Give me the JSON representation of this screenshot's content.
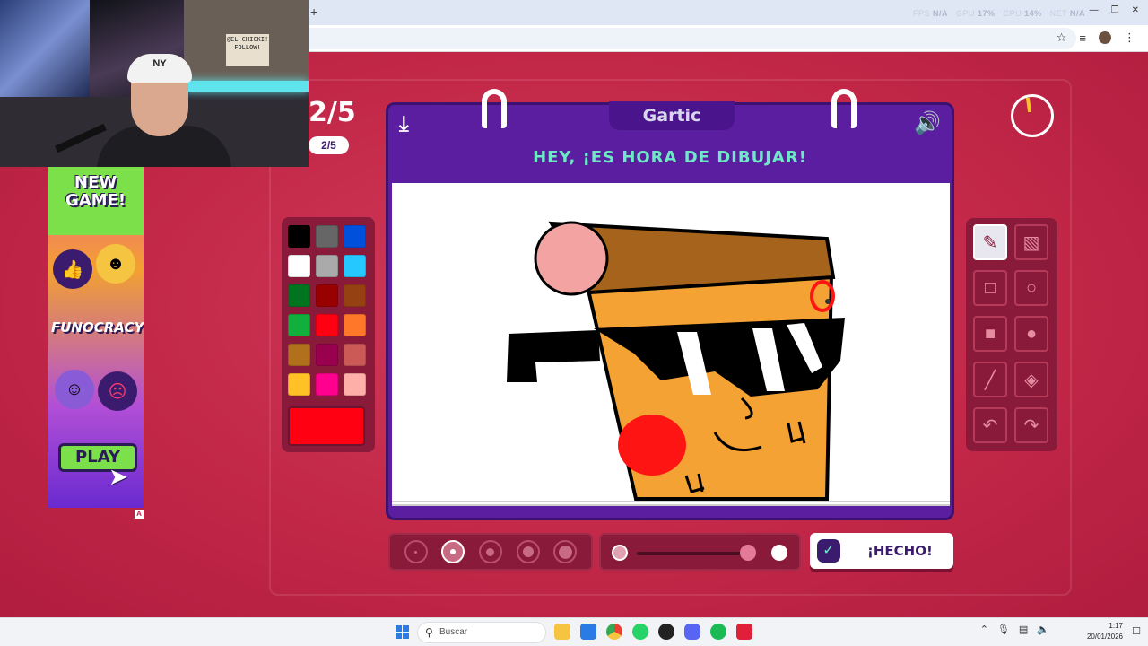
{
  "browser": {
    "newtab_glyph": "+",
    "metrics": [
      {
        "label": "FPS",
        "value": "N/A"
      },
      {
        "label": "GPU",
        "value": "17%"
      },
      {
        "label": "CPU",
        "value": "14%"
      },
      {
        "label": "NET",
        "value": "N/A"
      }
    ],
    "icons": [
      "star-icon",
      "reading-list-icon",
      "profile-avatar",
      "menu-icon"
    ]
  },
  "webcam": {
    "cap_text": "NY",
    "note_text": "@EL CHICKI! FOLLOW!"
  },
  "ad": {
    "headline": "NEW GAME!",
    "brand": "FUNOCRACY",
    "cta": "PLAY",
    "badge": "A"
  },
  "game": {
    "round_big": "2/5",
    "round_pill": "2/5",
    "logo": "Gartic",
    "prompt": "HEY, ¡ES HORA DE DIBUJAR!",
    "done_label": "¡HECHO!",
    "timer_icon": "timer-icon",
    "colors": {
      "palette": [
        "#000000",
        "#666666",
        "#0050dc",
        "#ffffff",
        "#aaaaaa",
        "#26c9ff",
        "#017420",
        "#990000",
        "#964112",
        "#11b03c",
        "#ff0013",
        "#ff7829",
        "#b0701c",
        "#99004e",
        "#cb5a57",
        "#ffc126",
        "#ff008f",
        "#feafa8"
      ],
      "current": "#ff0013",
      "accent": "#5b1ea0",
      "background": "#c9284a"
    },
    "tools": [
      {
        "name": "pencil",
        "icon": "pencil-icon",
        "active": true
      },
      {
        "name": "eraser",
        "icon": "eraser-icon",
        "active": false
      },
      {
        "name": "rectangle",
        "icon": "square-outline-icon",
        "active": false
      },
      {
        "name": "ellipse",
        "icon": "circle-outline-icon",
        "active": false
      },
      {
        "name": "filled-rectangle",
        "icon": "square-filled-icon",
        "active": false
      },
      {
        "name": "filled-ellipse",
        "icon": "circle-filled-icon",
        "active": false
      },
      {
        "name": "line",
        "icon": "line-icon",
        "active": false
      },
      {
        "name": "fill",
        "icon": "paint-bucket-icon",
        "active": false
      },
      {
        "name": "undo",
        "icon": "undo-icon",
        "active": false
      },
      {
        "name": "redo",
        "icon": "redo-icon",
        "active": false
      }
    ],
    "brush_sizes": {
      "count": 5,
      "selected": 2
    },
    "opacity": {
      "value": 0.95
    }
  },
  "taskbar": {
    "search_placeholder": "Buscar",
    "time": "1:17",
    "date": "20/01/2026"
  }
}
